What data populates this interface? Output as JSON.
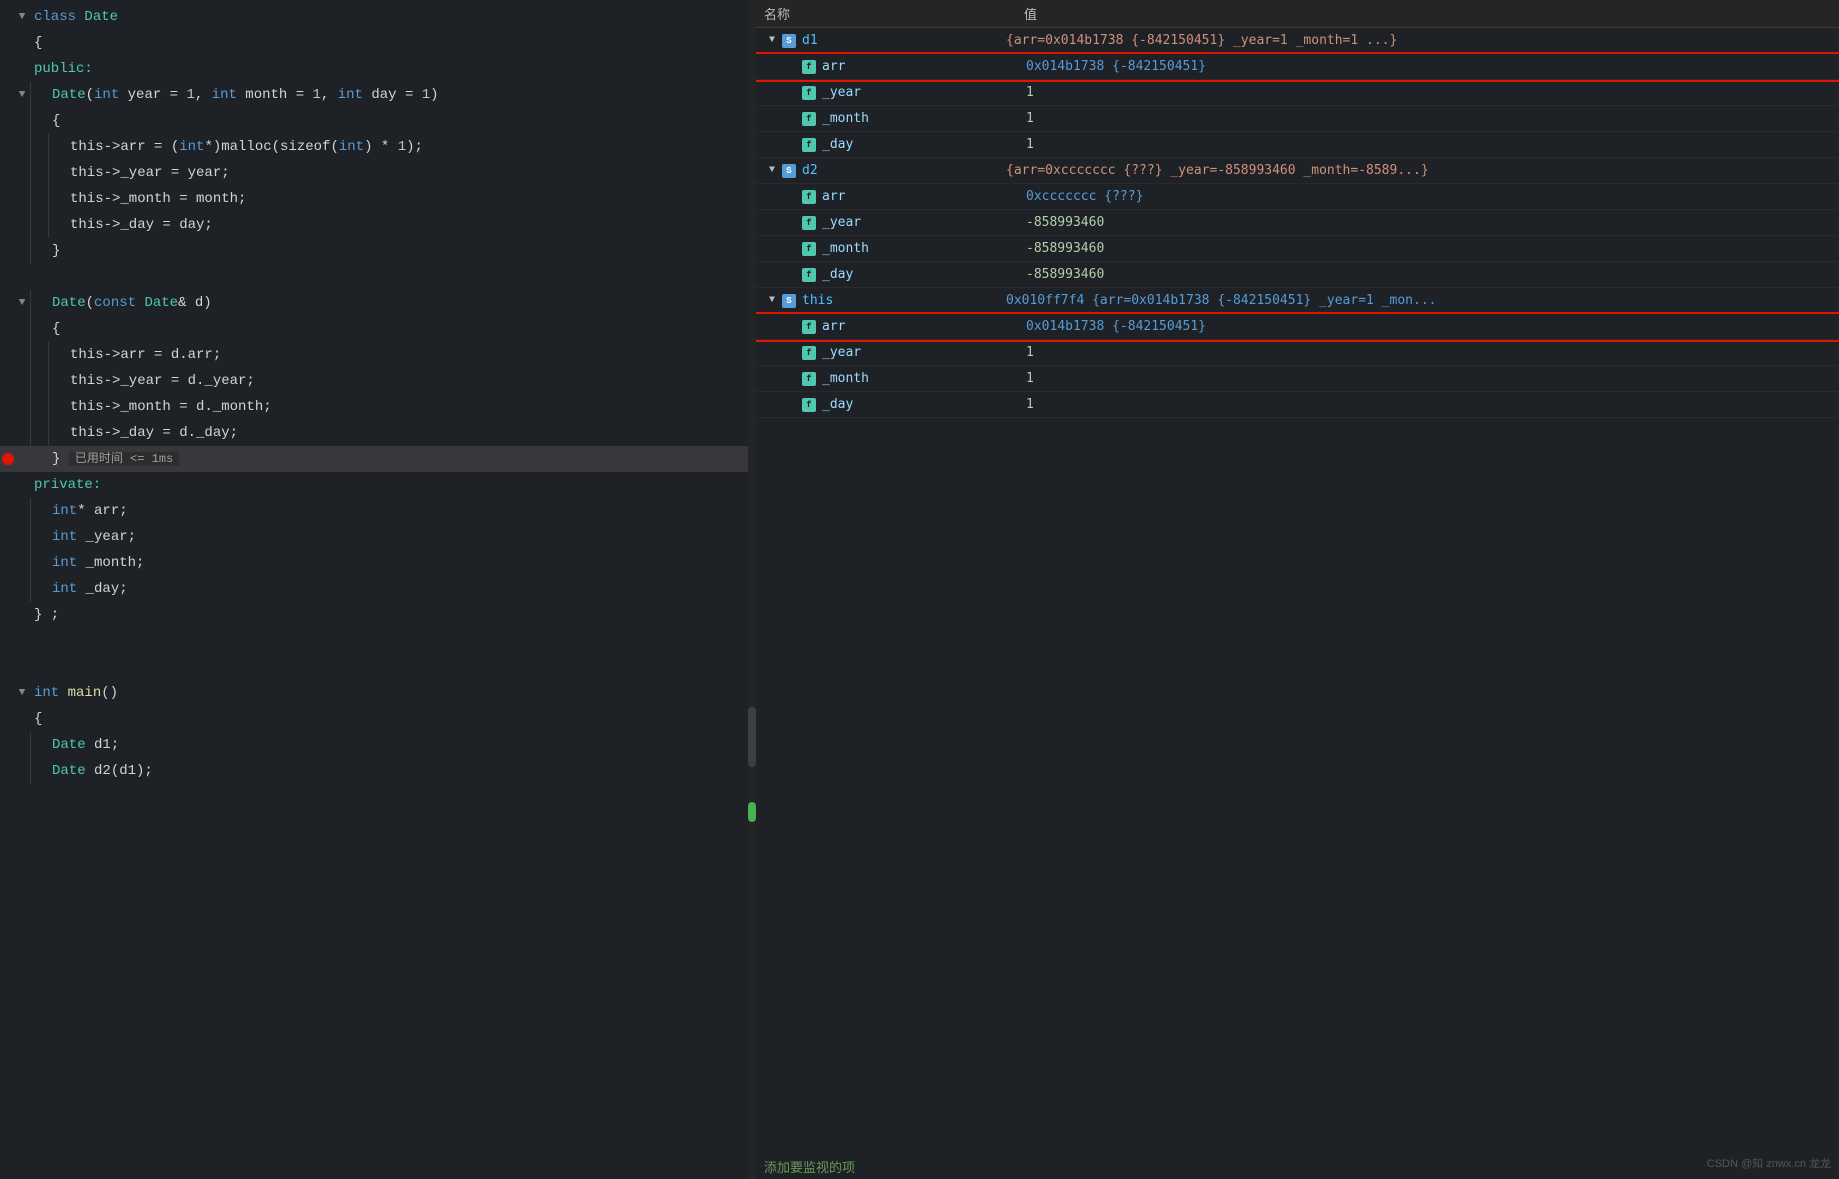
{
  "code": {
    "lines": [
      {
        "id": 1,
        "fold": "▼",
        "indent": 0,
        "tokens": [
          {
            "t": "class ",
            "c": "kw"
          },
          {
            "t": "Date",
            "c": "kw-cyan"
          }
        ],
        "gutter": ""
      },
      {
        "id": 2,
        "fold": "",
        "indent": 0,
        "tokens": [
          {
            "t": "{",
            "c": "plain"
          }
        ],
        "gutter": ""
      },
      {
        "id": 3,
        "fold": "",
        "indent": 0,
        "tokens": [
          {
            "t": "public:",
            "c": "label"
          }
        ],
        "gutter": ""
      },
      {
        "id": 4,
        "fold": "▼",
        "indent": 1,
        "tokens": [
          {
            "t": "Date",
            "c": "kw-cyan"
          },
          {
            "t": "(",
            "c": "plain"
          },
          {
            "t": "int",
            "c": "kw"
          },
          {
            "t": " year = ",
            "c": "plain"
          },
          {
            "t": "1",
            "c": "num"
          },
          {
            "t": ", ",
            "c": "plain"
          },
          {
            "t": "int",
            "c": "kw"
          },
          {
            "t": " month = ",
            "c": "plain"
          },
          {
            "t": "1",
            "c": "num"
          },
          {
            "t": ", ",
            "c": "plain"
          },
          {
            "t": "int",
            "c": "kw"
          },
          {
            "t": " day = ",
            "c": "plain"
          },
          {
            "t": "1",
            "c": "num"
          },
          {
            "t": ")",
            "c": "plain"
          }
        ],
        "gutter": ""
      },
      {
        "id": 5,
        "fold": "",
        "indent": 1,
        "tokens": [
          {
            "t": "{",
            "c": "plain"
          }
        ],
        "gutter": ""
      },
      {
        "id": 6,
        "fold": "",
        "indent": 2,
        "tokens": [
          {
            "t": "this->arr = (",
            "c": "plain"
          },
          {
            "t": "int",
            "c": "kw"
          },
          {
            "t": "*)malloc(sizeof(",
            "c": "plain"
          },
          {
            "t": "int",
            "c": "kw"
          },
          {
            "t": ") * ",
            "c": "plain"
          },
          {
            "t": "1",
            "c": "num"
          },
          {
            "t": ");",
            "c": "plain"
          }
        ],
        "gutter": ""
      },
      {
        "id": 7,
        "fold": "",
        "indent": 2,
        "tokens": [
          {
            "t": "this->_year = year;",
            "c": "plain"
          }
        ],
        "gutter": ""
      },
      {
        "id": 8,
        "fold": "",
        "indent": 2,
        "tokens": [
          {
            "t": "this->_month = month;",
            "c": "plain"
          }
        ],
        "gutter": ""
      },
      {
        "id": 9,
        "fold": "",
        "indent": 2,
        "tokens": [
          {
            "t": "this->_day = day;",
            "c": "plain"
          }
        ],
        "gutter": ""
      },
      {
        "id": 10,
        "fold": "",
        "indent": 1,
        "tokens": [
          {
            "t": "}",
            "c": "plain"
          }
        ],
        "gutter": ""
      },
      {
        "id": 11,
        "fold": "",
        "indent": 0,
        "tokens": [],
        "gutter": ""
      },
      {
        "id": 12,
        "fold": "▼",
        "indent": 1,
        "tokens": [
          {
            "t": "Date",
            "c": "kw-cyan"
          },
          {
            "t": "(",
            "c": "plain"
          },
          {
            "t": "const ",
            "c": "kw"
          },
          {
            "t": "Date",
            "c": "kw-cyan"
          },
          {
            "t": "& d)",
            "c": "plain"
          }
        ],
        "gutter": ""
      },
      {
        "id": 13,
        "fold": "",
        "indent": 1,
        "tokens": [
          {
            "t": "{",
            "c": "plain"
          }
        ],
        "gutter": ""
      },
      {
        "id": 14,
        "fold": "",
        "indent": 2,
        "tokens": [
          {
            "t": "this->arr = d.arr;",
            "c": "plain"
          }
        ],
        "gutter": ""
      },
      {
        "id": 15,
        "fold": "",
        "indent": 2,
        "tokens": [
          {
            "t": "this->_year = d._year;",
            "c": "plain"
          }
        ],
        "gutter": ""
      },
      {
        "id": 16,
        "fold": "",
        "indent": 2,
        "tokens": [
          {
            "t": "this->_month = d._month;",
            "c": "plain"
          }
        ],
        "gutter": ""
      },
      {
        "id": 17,
        "fold": "",
        "indent": 2,
        "tokens": [
          {
            "t": "this->_day = d._day;",
            "c": "plain"
          }
        ],
        "gutter": ""
      },
      {
        "id": 18,
        "fold": "",
        "indent": 1,
        "tokens": [
          {
            "t": "} ",
            "c": "plain"
          },
          {
            "t": "已用时间 <= 1ms",
            "c": "timing"
          }
        ],
        "gutter": "",
        "active": true
      },
      {
        "id": 19,
        "fold": "",
        "indent": 0,
        "tokens": [
          {
            "t": "private:",
            "c": "label"
          }
        ],
        "gutter": ""
      },
      {
        "id": 20,
        "fold": "",
        "indent": 1,
        "tokens": [
          {
            "t": "int",
            "c": "kw"
          },
          {
            "t": "* arr;",
            "c": "plain"
          }
        ],
        "gutter": ""
      },
      {
        "id": 21,
        "fold": "",
        "indent": 1,
        "tokens": [
          {
            "t": "int",
            "c": "kw"
          },
          {
            "t": " _year;",
            "c": "plain"
          }
        ],
        "gutter": ""
      },
      {
        "id": 22,
        "fold": "",
        "indent": 1,
        "tokens": [
          {
            "t": "int",
            "c": "kw"
          },
          {
            "t": " _month;",
            "c": "plain"
          }
        ],
        "gutter": ""
      },
      {
        "id": 23,
        "fold": "",
        "indent": 1,
        "tokens": [
          {
            "t": "int",
            "c": "kw"
          },
          {
            "t": " _day;",
            "c": "plain"
          }
        ],
        "gutter": ""
      },
      {
        "id": 24,
        "fold": "",
        "indent": 0,
        "tokens": [
          {
            "t": "} ;",
            "c": "plain"
          }
        ],
        "gutter": ""
      },
      {
        "id": 25,
        "fold": "",
        "indent": 0,
        "tokens": [],
        "gutter": ""
      },
      {
        "id": 26,
        "fold": "",
        "indent": 0,
        "tokens": [],
        "gutter": ""
      },
      {
        "id": 27,
        "fold": "▼",
        "indent": 0,
        "tokens": [
          {
            "t": "int",
            "c": "kw"
          },
          {
            "t": " ",
            "c": "plain"
          },
          {
            "t": "main",
            "c": "fn"
          },
          {
            "t": "()",
            "c": "plain"
          }
        ],
        "gutter": ""
      },
      {
        "id": 28,
        "fold": "",
        "indent": 0,
        "tokens": [
          {
            "t": "{",
            "c": "plain"
          }
        ],
        "gutter": ""
      },
      {
        "id": 29,
        "fold": "",
        "indent": 1,
        "tokens": [
          {
            "t": "Date",
            "c": "kw-cyan"
          },
          {
            "t": " d1;",
            "c": "plain"
          }
        ],
        "gutter": ""
      },
      {
        "id": 30,
        "fold": "",
        "indent": 1,
        "tokens": [
          {
            "t": "Date",
            "c": "kw-cyan"
          },
          {
            "t": " d2(d1);",
            "c": "plain"
          }
        ],
        "gutter": ""
      }
    ]
  },
  "watch": {
    "header": {
      "name_label": "名称",
      "value_label": "值"
    },
    "items": [
      {
        "id": "d1",
        "level": 0,
        "expanded": true,
        "name": "d1",
        "value": "{arr=0x014b1738 {-842150451} _year=1 _month=1 ...}",
        "type": "struct"
      },
      {
        "id": "d1.arr",
        "level": 1,
        "expanded": false,
        "name": "arr",
        "value": "0x014b1738 {-842150451}",
        "type": "field",
        "highlighted": true
      },
      {
        "id": "d1._year",
        "level": 1,
        "expanded": false,
        "name": "_year",
        "value": "1",
        "type": "field"
      },
      {
        "id": "d1._month",
        "level": 1,
        "expanded": false,
        "name": "_month",
        "value": "1",
        "type": "field"
      },
      {
        "id": "d1._day",
        "level": 1,
        "expanded": false,
        "name": "_day",
        "value": "1",
        "type": "field"
      },
      {
        "id": "d2",
        "level": 0,
        "expanded": true,
        "name": "d2",
        "value": "{arr=0xccccccc {???} _year=-858993460 _month=-8589...}",
        "type": "struct"
      },
      {
        "id": "d2.arr",
        "level": 1,
        "expanded": false,
        "name": "arr",
        "value": "0xccccccc {???}",
        "type": "field"
      },
      {
        "id": "d2._year",
        "level": 1,
        "expanded": false,
        "name": "_year",
        "value": "-858993460",
        "type": "field"
      },
      {
        "id": "d2._month",
        "level": 1,
        "expanded": false,
        "name": "_month",
        "value": "-858993460",
        "type": "field"
      },
      {
        "id": "d2._day",
        "level": 1,
        "expanded": false,
        "name": "_day",
        "value": "-858993460",
        "type": "field"
      },
      {
        "id": "this",
        "level": 0,
        "expanded": true,
        "name": "this",
        "value": "0x010ff7f4 {arr=0x014b1738 {-842150451} _year=1 _mon...",
        "type": "struct"
      },
      {
        "id": "this.arr",
        "level": 1,
        "expanded": false,
        "name": "arr",
        "value": "0x014b1738 {-842150451}",
        "type": "field",
        "highlighted": true
      },
      {
        "id": "this._year",
        "level": 1,
        "expanded": false,
        "name": "_year",
        "value": "1",
        "type": "field"
      },
      {
        "id": "this._month",
        "level": 1,
        "expanded": false,
        "name": "_month",
        "value": "1",
        "type": "field"
      },
      {
        "id": "this._day",
        "level": 1,
        "expanded": false,
        "name": "_day",
        "value": "1",
        "type": "field"
      }
    ],
    "add_watch_label": "添加要监视的项",
    "watermark": "CSDN @知 znwx.cn 龙龙"
  }
}
